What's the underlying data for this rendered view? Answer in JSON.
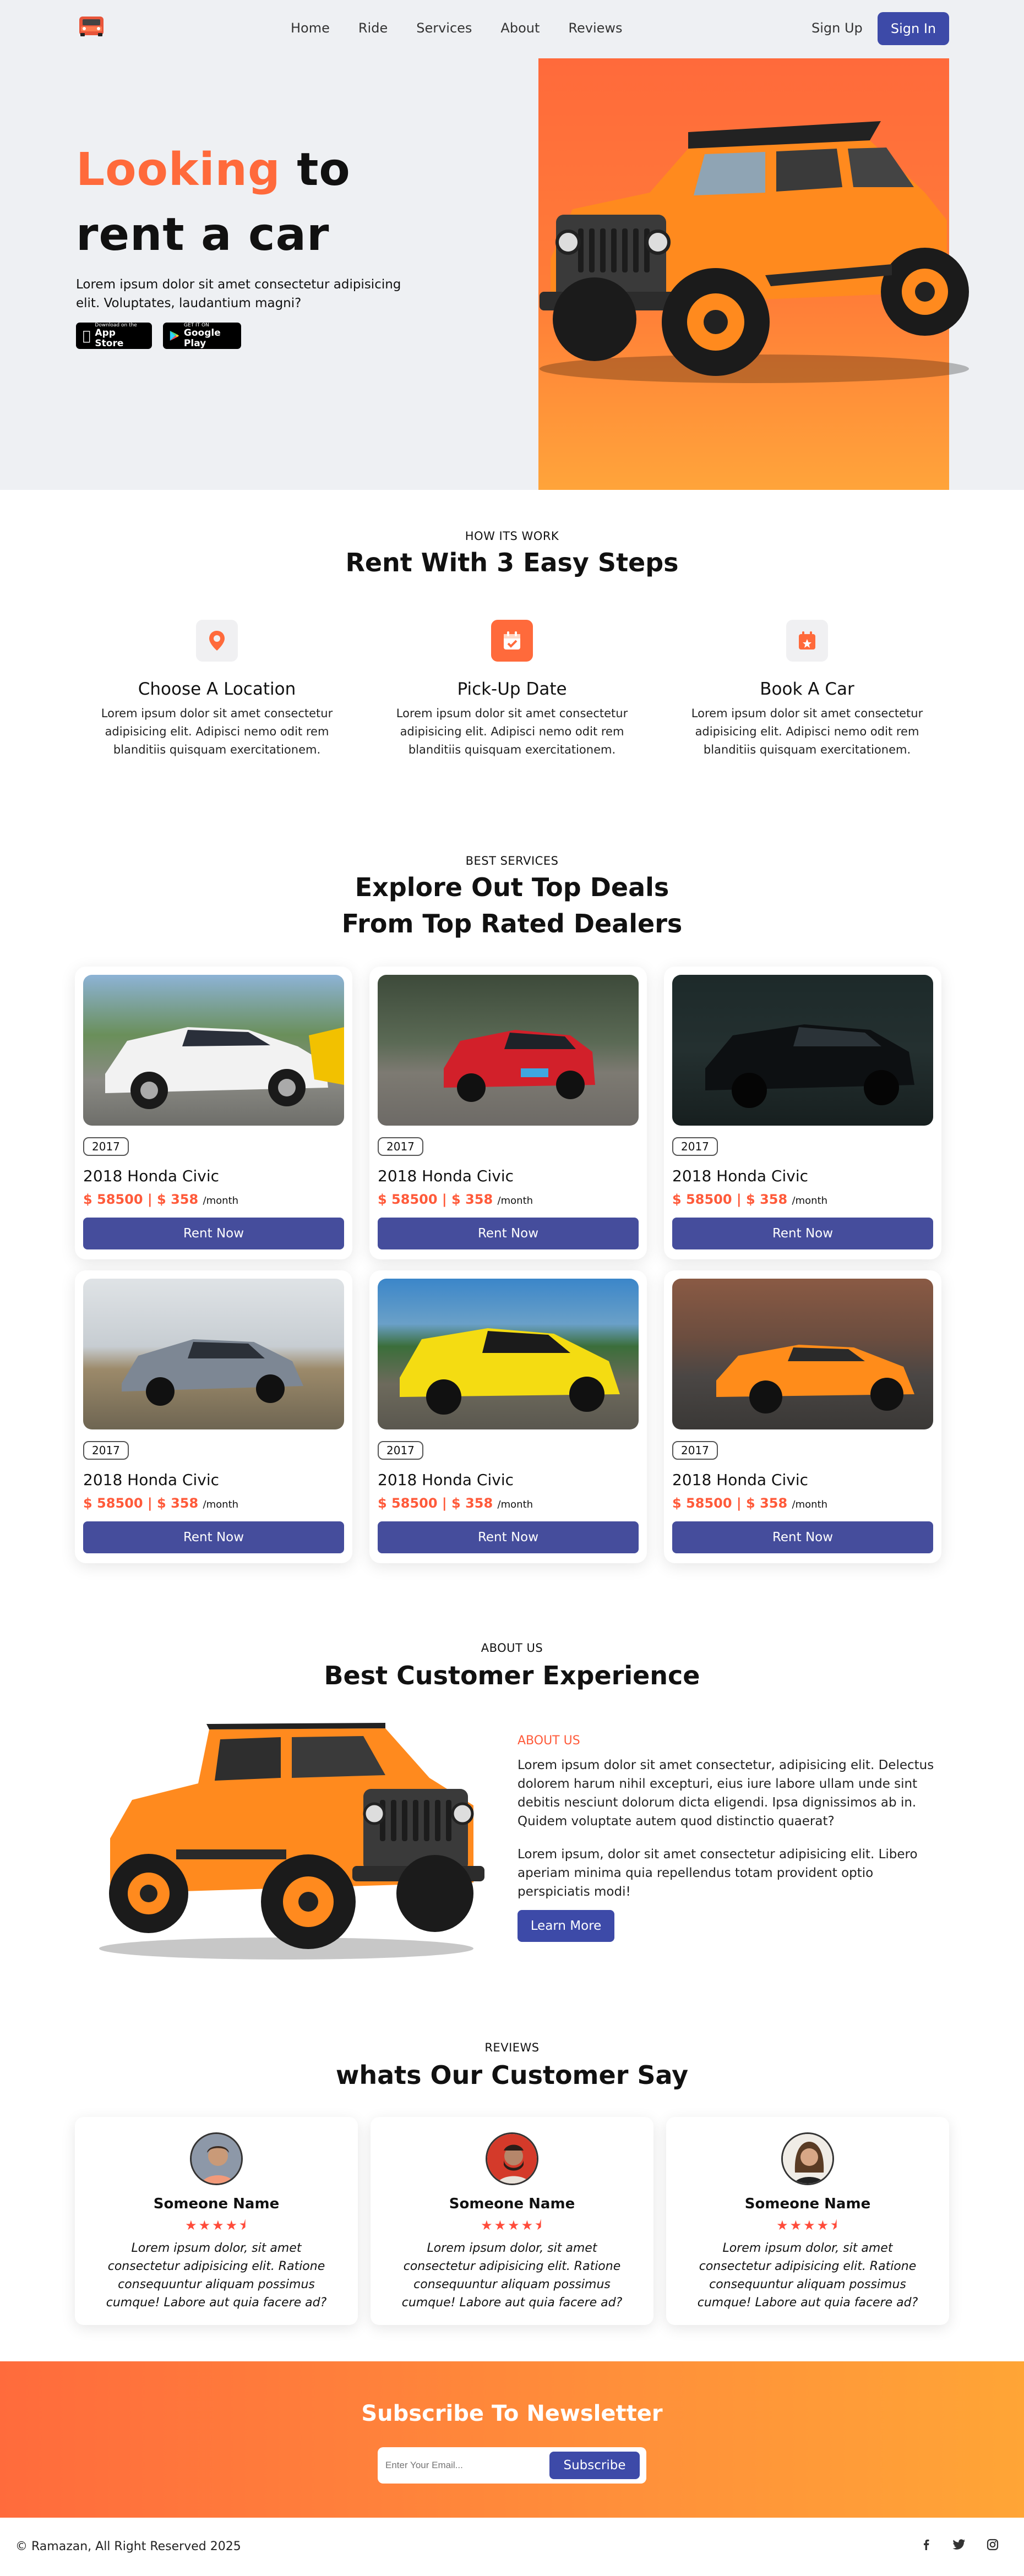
{
  "nav": {
    "items": [
      "Home",
      "Ride",
      "Services",
      "About",
      "Reviews"
    ],
    "signup": "Sign Up",
    "signin": "Sign In"
  },
  "hero": {
    "title_highlight": "Looking",
    "title_rest1": "to",
    "title_rest2": "rent a car",
    "desc": "Lorem ipsum dolor sit amet consectetur adipisicing elit. Voluptates, laudantium magni?",
    "appstore_sub": "Download on the",
    "appstore_main": "App Store",
    "googleplay_sub": "GET IT ON",
    "googleplay_main": "Google Play"
  },
  "how": {
    "kicker": "HOW ITS WORK",
    "title": "Rent With 3 Easy Steps",
    "steps": [
      {
        "title": "Choose A Location",
        "icon": "location-pin-icon",
        "text": "Lorem ipsum dolor sit amet consectetur adipisicing elit. Adipisci nemo odit rem blanditiis quisquam exercitationem."
      },
      {
        "title": "Pick-Up Date",
        "icon": "calendar-check-icon",
        "text": "Lorem ipsum dolor sit amet consectetur adipisicing elit. Adipisci nemo odit rem blanditiis quisquam exercitationem."
      },
      {
        "title": "Book A Car",
        "icon": "calendar-star-icon",
        "text": "Lorem ipsum dolor sit amet consectetur adipisicing elit. Adipisci nemo odit rem blanditiis quisquam exercitationem."
      }
    ]
  },
  "services": {
    "kicker": "BEST SERVICES",
    "title1": "Explore Out Top Deals",
    "title2": "From Top Rated Dealers",
    "cards": [
      {
        "year": "2017",
        "name": "2018 Honda Civic",
        "price": "$ 58500 | $ 358",
        "per": "/month",
        "button": "Rent Now"
      },
      {
        "year": "2017",
        "name": "2018 Honda Civic",
        "price": "$ 58500 | $ 358",
        "per": "/month",
        "button": "Rent Now"
      },
      {
        "year": "2017",
        "name": "2018 Honda Civic",
        "price": "$ 58500 | $ 358",
        "per": "/month",
        "button": "Rent Now"
      },
      {
        "year": "2017",
        "name": "2018 Honda Civic",
        "price": "$ 58500 | $ 358",
        "per": "/month",
        "button": "Rent Now"
      },
      {
        "year": "2017",
        "name": "2018 Honda Civic",
        "price": "$ 58500 | $ 358",
        "per": "/month",
        "button": "Rent Now"
      },
      {
        "year": "2017",
        "name": "2018 Honda Civic",
        "price": "$ 58500 | $ 358",
        "per": "/month",
        "button": "Rent Now"
      }
    ]
  },
  "about": {
    "kicker": "ABOUT US",
    "title": "Best Customer Experience",
    "label": "ABOUT US",
    "p1": "Lorem ipsum dolor sit amet consectetur, adipisicing elit. Delectus dolorem harum nihil excepturi, eius iure labore ullam unde sint debitis nesciunt dolorum dicta eligendi. Ipsa dignissimos ab in. Quidem voluptate autem quod distinctio quaerat?",
    "p2": "Lorem ipsum, dolor sit amet consectetur adipisicing elit. Libero aperiam minima quia repellendus totam provident optio perspiciatis modi!",
    "button": "Learn More"
  },
  "reviews": {
    "kicker": "REVIEWS",
    "title": "whats Our Customer Say",
    "rating": 4.5,
    "items": [
      {
        "name": "Someone Name",
        "stars": "★★★★⯨",
        "text": "Lorem ipsum dolor, sit amet consectetur adipisicing elit. Ratione consequuntur aliquam possimus cumque! Labore aut quia facere ad?"
      },
      {
        "name": "Someone Name",
        "stars": "★★★★⯨",
        "text": "Lorem ipsum dolor, sit amet consectetur adipisicing elit. Ratione consequuntur aliquam possimus cumque! Labore aut quia facere ad?"
      },
      {
        "name": "Someone Name",
        "stars": "★★★★⯨",
        "text": "Lorem ipsum dolor, sit amet consectetur adipisicing elit. Ratione consequuntur aliquam possimus cumque! Labore aut quia facere ad?"
      }
    ]
  },
  "newsletter": {
    "title": "Subscribe To Newsletter",
    "placeholder": "Enter Your Email...",
    "button": "Subscribe"
  },
  "footer": {
    "copyright": "© Ramazan, All Right Reserved 2025",
    "social": [
      "facebook-icon",
      "twitter-icon",
      "instagram-icon"
    ]
  },
  "colors": {
    "accent": "#ff6a3b",
    "primary": "#3d4aa8",
    "button": "#454d9c",
    "hero_bg": "#eef0f3"
  }
}
